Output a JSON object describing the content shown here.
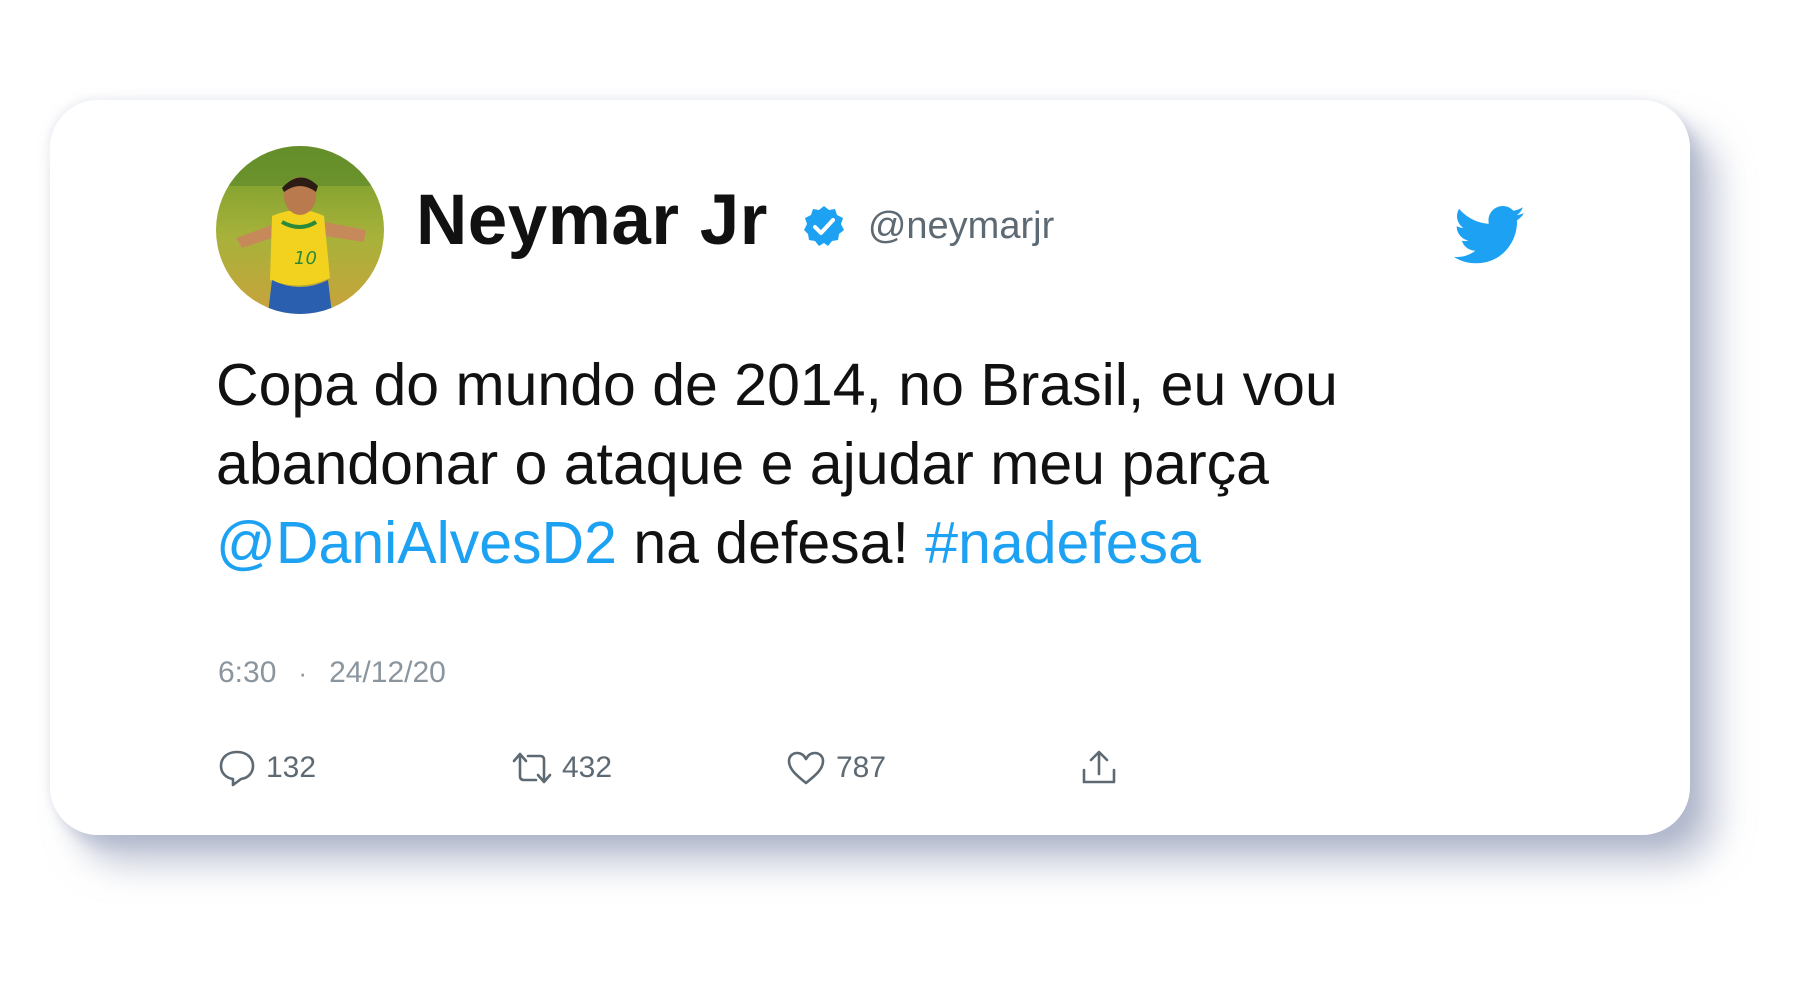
{
  "tweet": {
    "author_name": "Neymar Jr",
    "handle": "@neymarjr",
    "verified_icon": "verified-badge-icon",
    "text_main_1": "Copa do mundo de 2014, no Brasil, eu vou abandonar o ataque e ajudar meu parça ",
    "mention": "@DaniAlvesD2",
    "text_main_2": " na defesa! ",
    "hashtag": "#nadefesa",
    "time": "6:30",
    "separator": "·",
    "date": "24/12/20"
  },
  "actions": {
    "reply_count": "132",
    "retweet_count": "432",
    "like_count": "787",
    "reply_icon": "reply-bubble-icon",
    "retweet_icon": "retweet-icon",
    "like_icon": "heart-icon",
    "share_icon": "share-icon"
  },
  "brand": {
    "icon": "twitter-bird-icon",
    "accent_color": "#1da1f2",
    "text_color": "#111111",
    "muted_color": "#8a959e"
  }
}
